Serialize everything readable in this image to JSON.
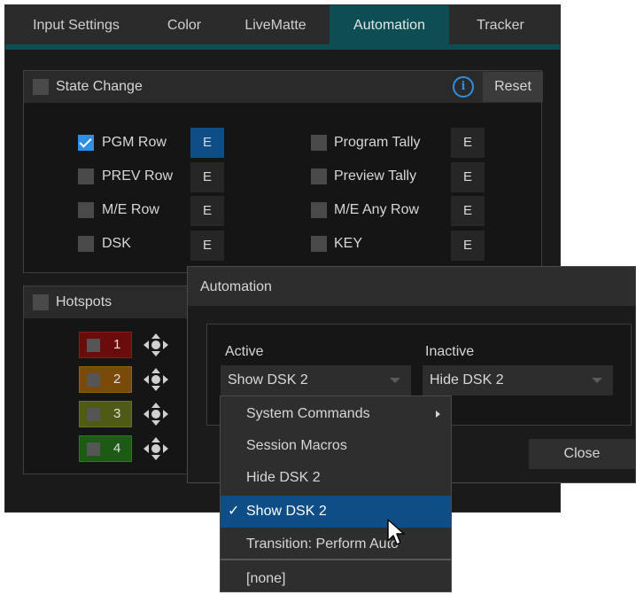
{
  "tabs": [
    {
      "label": "Input Settings"
    },
    {
      "label": "Color"
    },
    {
      "label": "LiveMatte"
    },
    {
      "label": "Automation",
      "active": true
    },
    {
      "label": "Tracker"
    }
  ],
  "state_change": {
    "title": "State Change",
    "reset_label": "Reset",
    "info_glyph": "i",
    "left": [
      {
        "label": "PGM Row",
        "checked": true,
        "e": "E",
        "e_active": true
      },
      {
        "label": "PREV Row",
        "checked": false,
        "e": "E"
      },
      {
        "label": "M/E Row",
        "checked": false,
        "e": "E"
      },
      {
        "label": "DSK",
        "checked": false,
        "e": "E"
      }
    ],
    "right": [
      {
        "label": "Program Tally",
        "checked": false,
        "e": "E"
      },
      {
        "label": "Preview Tally",
        "checked": false,
        "e": "E"
      },
      {
        "label": "M/E Any Row",
        "checked": false,
        "e": "E"
      },
      {
        "label": "KEY",
        "checked": false,
        "e": "E"
      }
    ]
  },
  "hotspots": {
    "title": "Hotspots",
    "items": [
      {
        "number": "1",
        "color": "#6b0c0c",
        "border": "#8c1a1a"
      },
      {
        "number": "2",
        "color": "#7a4a08",
        "border": "#9a6010"
      },
      {
        "number": "3",
        "color": "#4f5a14",
        "border": "#687420"
      },
      {
        "number": "4",
        "color": "#1d5a16",
        "border": "#2c7a22"
      }
    ]
  },
  "dialog": {
    "title": "Automation",
    "active_label": "Active",
    "active_value": "Show DSK 2",
    "inactive_label": "Inactive",
    "inactive_value": "Hide DSK 2",
    "close_label": "Close"
  },
  "menu": {
    "items": [
      {
        "label": "System Commands",
        "submenu": true
      },
      {
        "label": "Session Macros"
      },
      {
        "label": "Hide DSK 2"
      },
      {
        "label": "Show DSK 2",
        "selected": true,
        "check": "✓"
      },
      {
        "label": "Transition: Perform Auto"
      },
      {
        "label": "[none]"
      }
    ]
  },
  "colors": {
    "accent": "#2e8fe6",
    "tab_active": "#0d4e55",
    "selection": "#0f4d86"
  }
}
